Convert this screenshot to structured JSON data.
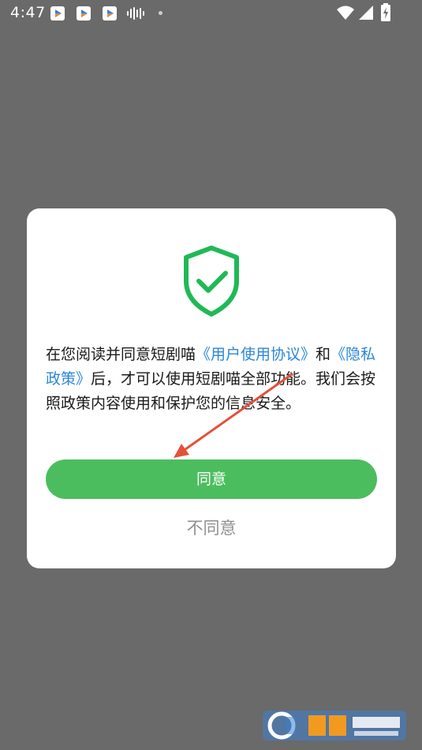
{
  "status_bar": {
    "time": "4:47",
    "notification_icons": [
      "app-icon",
      "app-icon",
      "app-icon",
      "sound-wave-icon",
      "dot-icon"
    ],
    "right_icons": [
      "wifi-icon",
      "signal-icon",
      "battery-charging-icon"
    ]
  },
  "dialog": {
    "icon": "shield-check-icon",
    "message": {
      "part1": "在您阅读并同意短剧喵",
      "link1": "《用户使用协议》",
      "part2": "和",
      "link2": "《隐私政策》",
      "part3": "后，才可以使用短剧喵全部功能。我们会按照政策内容使用和保护您的信息安全。"
    },
    "agree_label": "同意",
    "disagree_label": "不同意"
  },
  "colors": {
    "overlay": "#6a6a6a",
    "accent_green": "#4cbd5e",
    "shield_green": "#1fb955",
    "link_blue": "#2a86d8",
    "annotation_arrow": "#e4513a"
  }
}
